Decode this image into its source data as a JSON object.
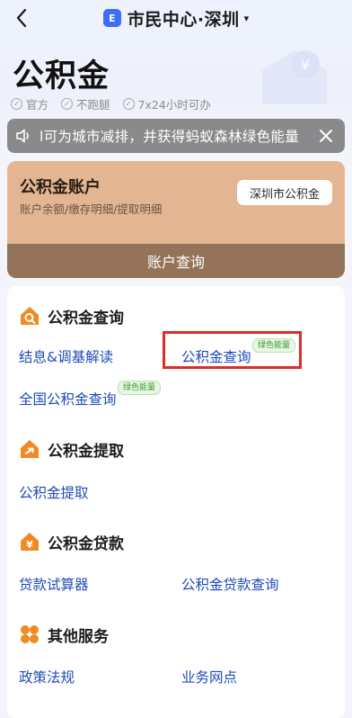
{
  "nav": {
    "title": "市民中心·深圳",
    "caret": "▾",
    "logo_glyph": "E"
  },
  "page": {
    "title": "公积金",
    "badges": [
      "官方",
      "不跑腿",
      "7x24小时可办"
    ]
  },
  "notice": {
    "text": "l可为城市减排，并获得蚂蚁森林绿色能量"
  },
  "account": {
    "title": "公积金账户",
    "subtitle": "账户余额/缴存明细/提取明细",
    "city_button": "深圳市公积金",
    "query_button": "账户查询"
  },
  "sections": {
    "query": {
      "title": "公积金查询",
      "links": [
        "结息&调基解读",
        "公积金查询",
        "全国公积金查询"
      ],
      "green_tag": "绿色能量"
    },
    "withdraw": {
      "title": "公积金提取",
      "links": [
        "公积金提取"
      ]
    },
    "loan": {
      "title": "公积金贷款",
      "links": [
        "贷款试算器",
        "公积金贷款查询"
      ]
    },
    "other": {
      "title": "其他服务",
      "links": [
        "政策法规",
        "业务网点"
      ]
    }
  },
  "colors": {
    "accent_orange": "#f08a24",
    "account_card": "#e3b593",
    "link_blue": "#1f4bb8",
    "highlight_red": "#e02b2b"
  }
}
